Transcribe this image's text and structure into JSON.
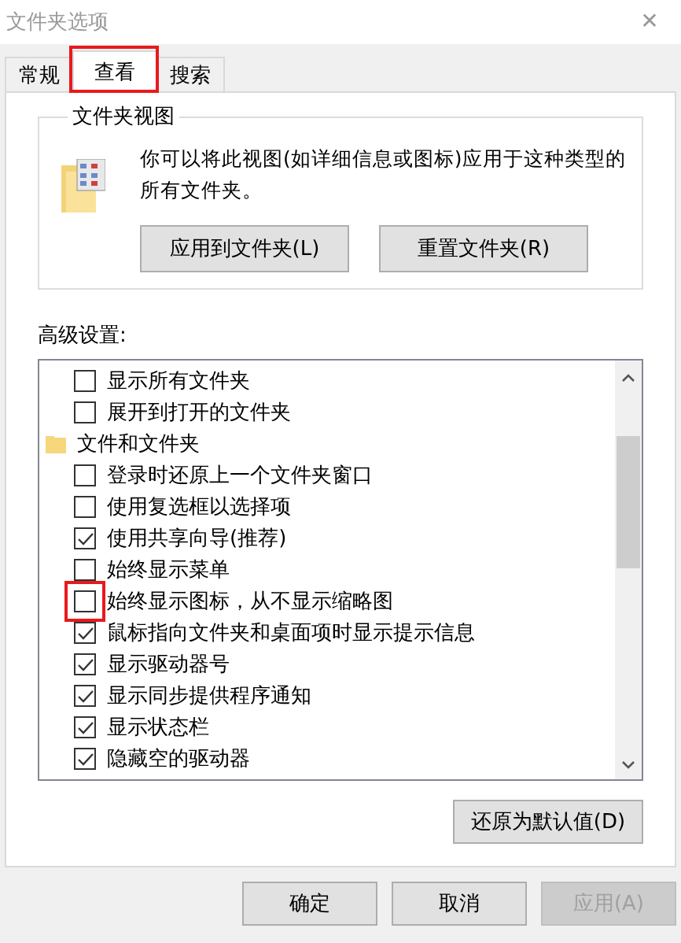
{
  "window": {
    "title": "文件夹选项",
    "close": "✕"
  },
  "tabs": [
    {
      "label": "常规",
      "selected": false,
      "highlighted": false
    },
    {
      "label": "查看",
      "selected": true,
      "highlighted": true
    },
    {
      "label": "搜索",
      "selected": false,
      "highlighted": false
    }
  ],
  "folder_views": {
    "title": "文件夹视图",
    "description": "你可以将此视图(如详细信息或图标)应用于这种类型的所有文件夹。",
    "buttons": [
      "应用到文件夹(L)",
      "重置文件夹(R)"
    ]
  },
  "advanced_settings": {
    "label": "高级设置:",
    "items": [
      {
        "kind": "checkbox",
        "label": "显示所有文件夹",
        "checked": false,
        "highlighted": false
      },
      {
        "kind": "checkbox",
        "label": "展开到打开的文件夹",
        "checked": false,
        "highlighted": false
      },
      {
        "kind": "folder",
        "label": "文件和文件夹",
        "children": [
          {
            "kind": "checkbox",
            "label": "登录时还原上一个文件夹窗口",
            "checked": false,
            "highlighted": false
          },
          {
            "kind": "checkbox",
            "label": "使用复选框以选择项",
            "checked": false,
            "highlighted": false
          },
          {
            "kind": "checkbox",
            "label": "使用共享向导(推荐)",
            "checked": true,
            "highlighted": false
          },
          {
            "kind": "checkbox",
            "label": "始终显示菜单",
            "checked": false,
            "highlighted": false
          },
          {
            "kind": "checkbox",
            "label": "始终显示图标，从不显示缩略图",
            "checked": false,
            "highlighted": true
          },
          {
            "kind": "checkbox",
            "label": "鼠标指向文件夹和桌面项时显示提示信息",
            "checked": true,
            "highlighted": false
          },
          {
            "kind": "checkbox",
            "label": "显示驱动器号",
            "checked": true,
            "highlighted": false
          },
          {
            "kind": "checkbox",
            "label": "显示同步提供程序通知",
            "checked": true,
            "highlighted": false
          },
          {
            "kind": "checkbox",
            "label": "显示状态栏",
            "checked": true,
            "highlighted": false
          },
          {
            "kind": "checkbox",
            "label": "隐藏空的驱动器",
            "checked": true,
            "highlighted": false
          }
        ]
      }
    ],
    "restore_button": "还原为默认值(D)"
  },
  "buttons": [
    {
      "label": "确定",
      "disabled": false
    },
    {
      "label": "取消",
      "disabled": false
    },
    {
      "label": "应用(A)",
      "disabled": true
    }
  ]
}
